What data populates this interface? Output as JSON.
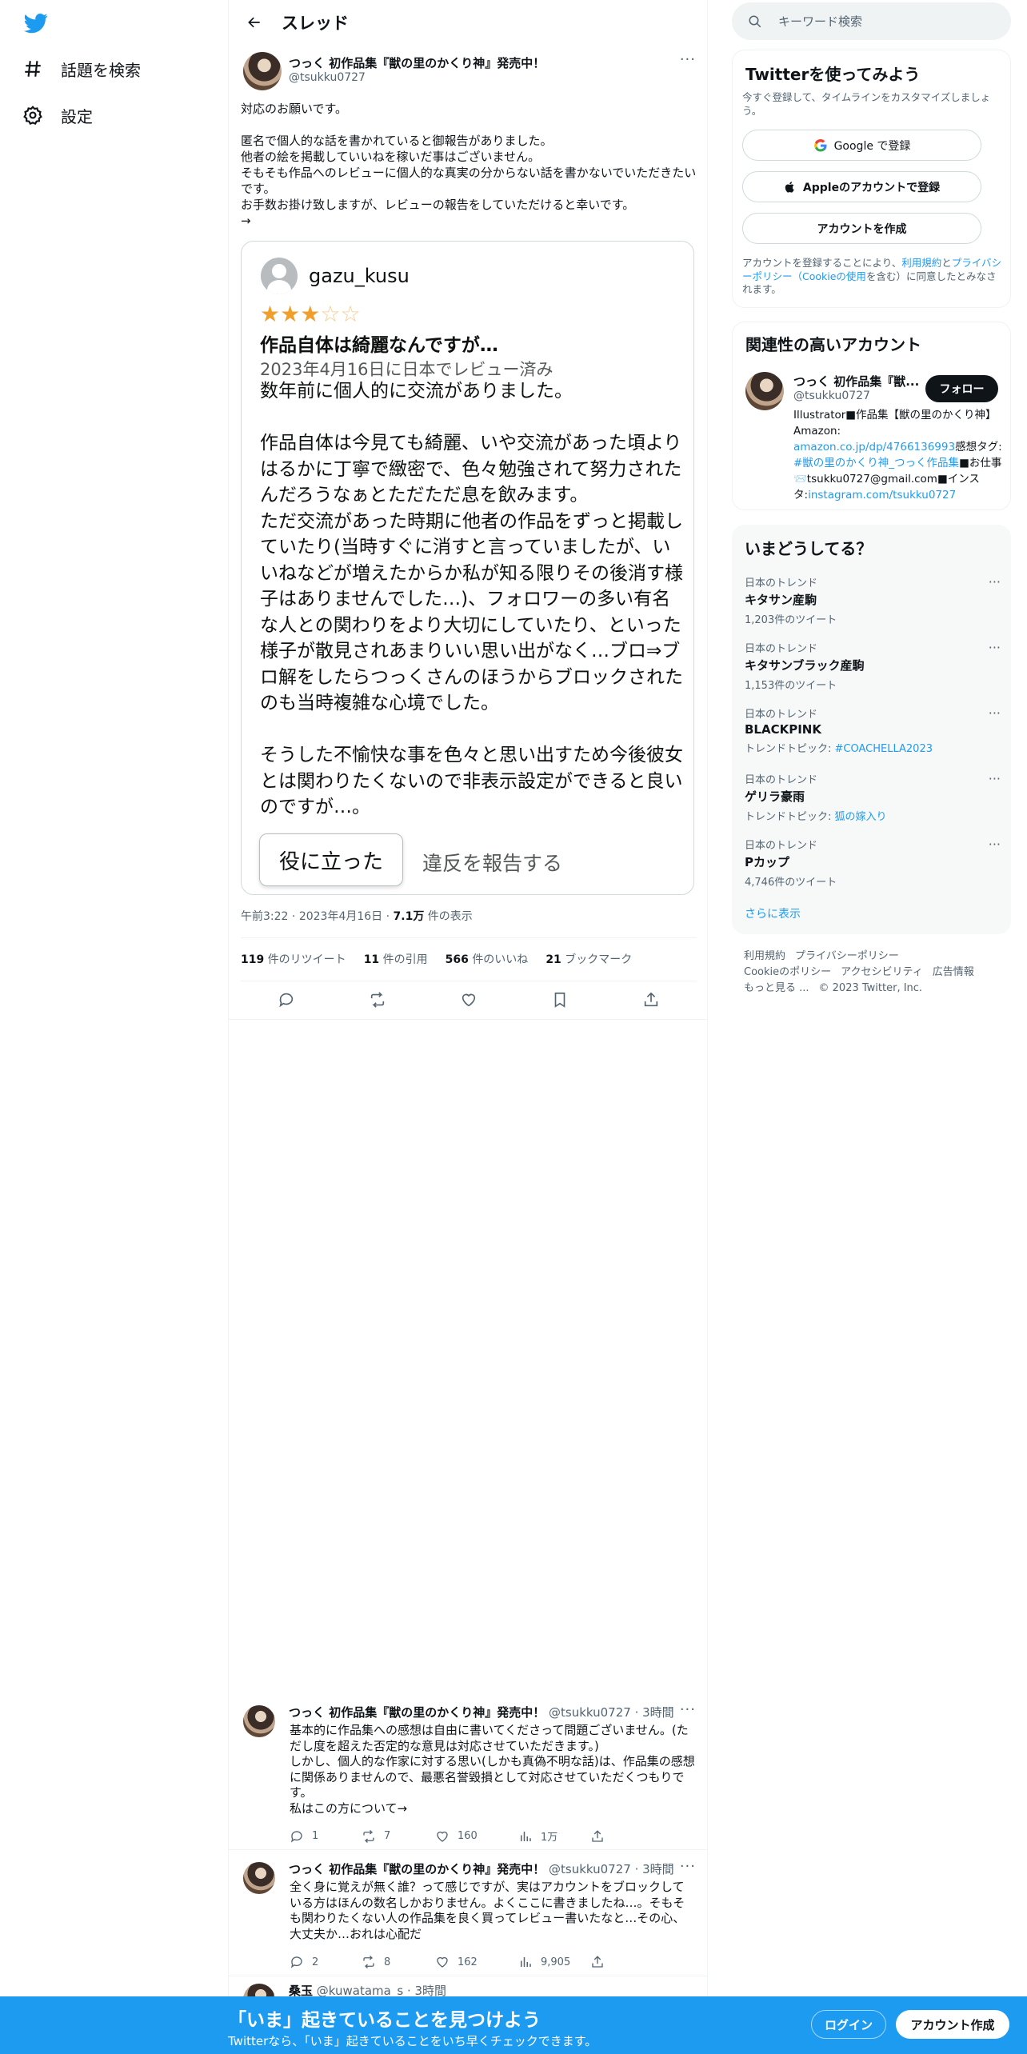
{
  "nav": {
    "logo": "twitter-bird",
    "explore_label": "話題を検索",
    "settings_label": "設定"
  },
  "header": {
    "title": "スレッド"
  },
  "main_tweet": {
    "author_name": "つっく 初作品集『獣の里のかくり神』発売中！",
    "author_handle": "@tsukku0727",
    "more": "···",
    "text": "対応のお願いです。\n\n匿名で個人的な話を書かれていると御報告がありました。\n他者の絵を掲載していいねを稼いだ事はございません。\nそもそも作品へのレビューに個人的な真実の分からない話を書かないでいただきたいです。\nお手数お掛け致しますが、レビューの報告をしていただけると幸いです。\n→",
    "card": {
      "reviewer": "gazu_kusu",
      "stars_filled": 3,
      "stars_total": 5,
      "star_char": "★",
      "star_empty_char": "☆",
      "review_title": "作品自体は綺麗なんですが…",
      "review_date": "2023年4月16日に日本でレビュー済み",
      "review_text": "数年前に個人的に交流がありました。\n\n作品自体は今見ても綺麗、いや交流があった頃よりはるかに丁寧で緻密で、色々勉強されて努力されたんだろうなぁとただただ息を飲みます。\nただ交流があった時期に他者の作品をずっと掲載していたり(当時すぐに消すと言っていましたが、いいねなどが増えたからか私が知る限りその後消す様子はありませんでした…)、フォロワーの多い有名な人との関わりをより大切にしていたり、といった様子が散見されあまりいい思い出がなく…ブロ⇒ブロ解をしたらつっくさんのほうからブロックされたのも当時複雑な心境でした。\n\nそうした不愉快な事を色々と思い出すため今後彼女とは関わりたくないので非表示設定ができると良いのですが…。",
      "helpful_label": "役に立った",
      "report_label": "違反を報告する"
    },
    "time": "午前3:22",
    "date": "2023年4月16日",
    "views_count": "7.1万",
    "views_label": "件の表示",
    "stats": {
      "retweets_count": "119",
      "retweets_label": "件のリツイート",
      "quotes_count": "11",
      "quotes_label": "件の引用",
      "likes_count": "566",
      "likes_label": "件のいいね",
      "bookmarks_count": "21",
      "bookmarks_label": "ブックマーク"
    }
  },
  "replies": [
    {
      "author_name": "つっく 初作品集『獣の里のかくり神』発売中！",
      "author_handle": "@tsukku0727",
      "time": "3時間",
      "text": "基本的に作品集への感想は自由に書いてくださって問題ございません。(ただし度を超えた否定的な意見は対応させていただきます。)\nしかし、個人的な作家に対する思い(しかも真偽不明な話)は、作品集の感想に関係ありませんので、最悪名誉毀損として対応させていただくつもりです。\n私はこの方について→",
      "replies": "1",
      "retweets": "7",
      "likes": "160",
      "views": "1万"
    },
    {
      "author_name": "つっく 初作品集『獣の里のかくり神』発売中！",
      "author_handle": "@tsukku0727",
      "time": "3時間",
      "text": "全く身に覚えが無く誰？って感じですが、実はアカウントをブロックしている方はほんの数名しかおりません。よくここに書きましたね…。そもそも関わりたくない人の作品集を良く買ってレビュー書いたなと…その心、大丈夫か…おれは心配だ",
      "replies": "2",
      "retweets": "8",
      "likes": "162",
      "views": "9,905"
    }
  ],
  "partial_reply": {
    "author_name": "桑玉",
    "author_handle": "@kuwatama_s",
    "time": "3時間"
  },
  "sidebar": {
    "search_placeholder": "キーワード検索",
    "signup": {
      "title": "Twitterを使ってみよう",
      "subtitle": "今すぐ登録して、タイムラインをカスタマイズしましょう。",
      "google_label": "Google で登録",
      "apple_label": "Appleのアカウントで登録",
      "create_label": "アカウントを作成",
      "legal_prefix": "アカウントを登録することにより、",
      "terms_link": "利用規約",
      "and": "と",
      "privacy_link": "プライバシーポリシー（Cookieの使用",
      "legal_suffix": "を含む）に同意したとみなされます。"
    },
    "related": {
      "title": "関連性の高いアカウント",
      "name": "つっく 初作品集『獣...",
      "handle": "@tsukku0727",
      "follow_label": "フォロー",
      "bio_1": "Illustrator■作品集【獣の里のかくり神】Amazon: ",
      "bio_link_1": "amazon.co.jp/dp/4766136993",
      "bio_2": "感想タグ: ",
      "bio_link_2": "#獣の里のかくり神_つっく作品集",
      "bio_3": "■お仕事📨tsukku0727@gmail.com■インスタ:",
      "bio_link_3": "instagram.com/tsukku0727"
    },
    "trends": {
      "title": "いまどうしてる？",
      "items": [
        {
          "category": "日本のトレンド",
          "title": "キタサン産駒",
          "sub": "1,203件のツイート",
          "sub_link": ""
        },
        {
          "category": "日本のトレンド",
          "title": "キタサンブラック産駒",
          "sub": "1,153件のツイート",
          "sub_link": ""
        },
        {
          "category": "日本のトレンド",
          "title": "BLACKPINK",
          "sub": "トレンドトピック: ",
          "sub_link": "#COACHELLA2023"
        },
        {
          "category": "日本のトレンド",
          "title": "ゲリラ豪雨",
          "sub": "トレンドトピック: ",
          "sub_link": "狐の嫁入り"
        },
        {
          "category": "日本のトレンド",
          "title": "Pカップ",
          "sub": "4,746件のツイート",
          "sub_link": ""
        }
      ],
      "show_more": "さらに表示"
    },
    "footer": {
      "terms": "利用規約",
      "privacy": "プライバシーポリシー",
      "cookie": "Cookieのポリシー",
      "accessibility": "アクセシビリティ",
      "ads": "広告情報",
      "more": "もっと見る ...",
      "copyright": "© 2023 Twitter, Inc."
    }
  },
  "bottom_bar": {
    "headline": "「いま」起きていることを見つけよう",
    "sub": "Twitterなら、「いま」起きていることをいち早くチェックできます。",
    "login_label": "ログイン",
    "signup_label": "アカウント作成"
  },
  "colors": {
    "accent": "#1d9bf0",
    "star": "#f0a02a",
    "text": "#0f1419",
    "muted": "#536471"
  }
}
